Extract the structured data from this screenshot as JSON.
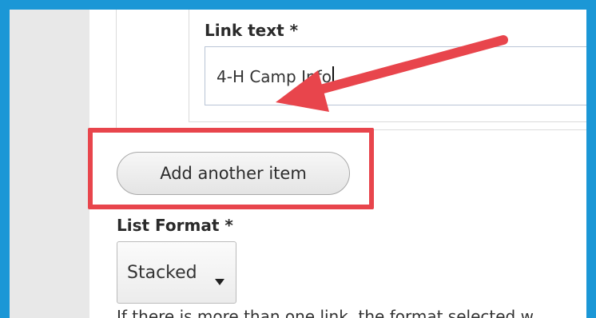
{
  "form": {
    "link_text_label": "Link text *",
    "link_text_value": "4-H Camp Info",
    "add_button_label": "Add another item",
    "list_format_label": "List Format *",
    "list_format_selected": "Stacked",
    "helper_text": "If there is more than one link, the format selected w"
  },
  "annotation": {
    "highlight_color": "#e8454c",
    "arrow_color": "#e8454c",
    "frame_color": "#1b97d6"
  }
}
